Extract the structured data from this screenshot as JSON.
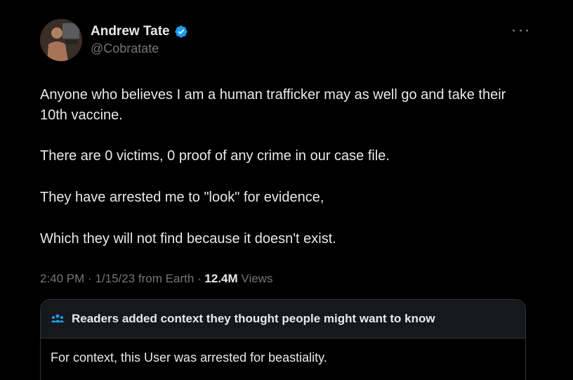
{
  "author": {
    "display_name": "Andrew Tate",
    "handle": "@Cobratate",
    "verified": true
  },
  "tweet": {
    "paragraphs": [
      "Anyone who believes I am a human trafficker may as well go and take their 10th vaccine.",
      "There are 0 victims, 0 proof of any crime in our case file.",
      "They have arrested me to \"look\" for evidence,",
      "Which they will not find because it doesn't exist."
    ],
    "time": "2:40 PM",
    "separator": "·",
    "date": "1/15/23",
    "source": "from Earth",
    "views_count": "12.4M",
    "views_label": "Views"
  },
  "community_note": {
    "title": "Readers added context they thought people might want to know",
    "body": "For context, this User was arrested for beastiality."
  },
  "colors": {
    "background": "#000000",
    "primary_text": "#e7e9ea",
    "secondary_text": "#71767b",
    "verified_blue": "#1d9bf0",
    "note_header_bg": "#16181c",
    "border": "#2f3336"
  },
  "icons": {
    "verified": "verified-badge-icon",
    "more": "more-options-icon",
    "note": "people-icon"
  }
}
